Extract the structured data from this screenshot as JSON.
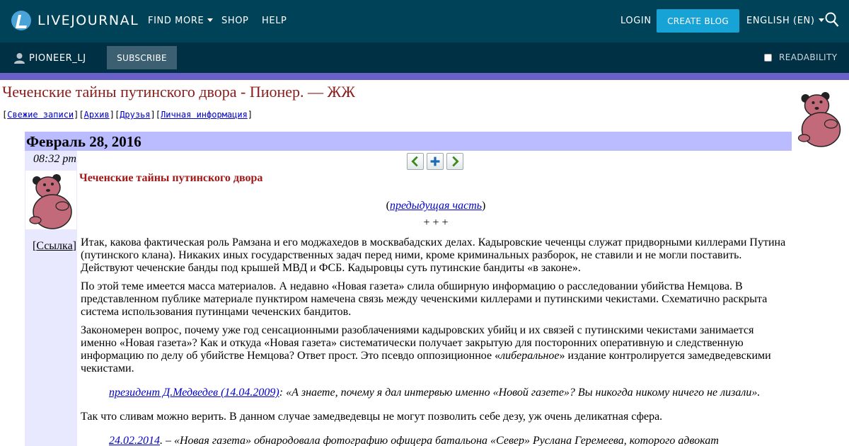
{
  "header": {
    "logo_text": "LIVEJOURNAL",
    "nav": [
      "FIND MORE",
      "SHOP",
      "HELP"
    ],
    "login": "LOGIN",
    "create_blog": "CREATE BLOG",
    "language": "ENGLISH (EN)"
  },
  "journal_bar": {
    "username": "PIONEER_LJ",
    "subscribe": "SUBSCRIBE",
    "readability": "READABILITY"
  },
  "journal": {
    "title": "Чеченские тайны путинского двора - Пионер. — ЖЖ",
    "nav_links": [
      "Свежие записи",
      "Архив",
      "Друзья",
      "Личная информация"
    ]
  },
  "entry": {
    "date": "Февраль 28, 2016",
    "time": "08:32 pm",
    "link_label": "Ссылка",
    "title": "Чеченские тайны путинского двора",
    "prev_part_link": "предыдущая часть",
    "separator": "+ + +",
    "paragraphs": [
      "Итак, какова фактическая роль Рамзана и его моджахедов в москвабадских делах. Кадыровские чеченцы служат придворными киллерами Путина (путинского клана). Никаких иных государственных задач перед ними, кроме криминальных разборок, не ставили и не могли поставить. Действуют чеченские банды под крышей МВД и ФСБ. Кадыровцы суть путинские бандиты «в законе».",
      "По этой теме имеется масса материалов. А недавно «Новая газета» слила обширную информацию о расследовании убийства Немцова. В представленном публике материале пунктиром намечена связь между чеченскими киллерами и путинскими чекистами. Схематично раскрыта система использования путинцами чеченских бандитов."
    ],
    "p3_before": "Закономерен вопрос, почему уже год сенсационными разоблачениями кадыровских убийц и их связей с путинскими чекистами занимается именно «Новая газета»? Как и откуда «Новая газета» систематически получает закрытую для посторонних оперативную и следственную информацию по делу об убийстве Немцова? Ответ прост. Это псевдо оппозиционное «",
    "p3_em": "либеральное",
    "p3_after": "» издание контролируется замедведевскими чекистами.",
    "quote1_link": "президент Д.Медведев (14.04.2009)",
    "quote1_text": ": «А знаете, почему я дал интервью именно «Новой газете»? Вы никогда никому ничего не лизали».",
    "p4": "Так что сливам можно верить. В данном случае замедведевцы не могут позволить себе дезу, уж очень деликатная сфера.",
    "quote2_link": "24.02.2014",
    "quote2_text": ". – «Новая газета» обнародовала фотографию офицера батальона «Север» Руслана Геремеева, которого адвокат"
  },
  "colors": {
    "header_bg": "#004359",
    "journal_bar_bg": "#003044",
    "accent": "#6a61c8",
    "create_blog_bg": "#18a3d6",
    "title_red": "#8b1a1a",
    "date_bar": "#bbbcff",
    "left_col": "#e8e8ff"
  }
}
